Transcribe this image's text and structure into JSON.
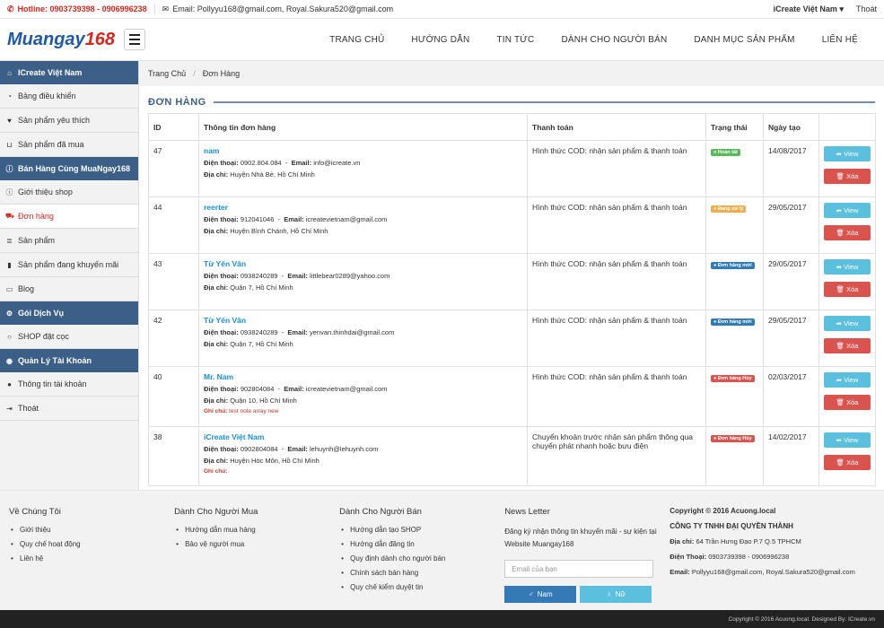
{
  "topbar": {
    "hotline": "Hotline: 0903739398 - 0906996238",
    "email": "Email: Pollyyu168@gmail.com, Royal.Sakura520@gmail.com",
    "user": "iCreate Việt Nam",
    "logout": "Thoát"
  },
  "logo": {
    "part1": "Muangay",
    "part2": "168"
  },
  "nav": [
    "TRANG CHỦ",
    "HƯỚNG DẪN",
    "TIN TỨC",
    "DÀNH CHO NGƯỜI BÁN",
    "DANH MỤC SẢN PHẨM",
    "LIÊN HỆ"
  ],
  "sidebar": {
    "h1": "ICreate Việt Nam",
    "g1": [
      "Bảng điều khiển",
      "Sản phẩm yêu thích",
      "Sản phẩm đã mua"
    ],
    "h2": "Bán Hàng Cùng MuaNgay168",
    "g2": [
      "Giới thiệu shop",
      "Đơn hàng",
      "Sản phẩm",
      "Sản phẩm đang khuyến mãi",
      "Blog"
    ],
    "h3": "Gói Dịch Vụ",
    "g3": [
      "SHOP đặt cọc"
    ],
    "h4": "Quản Lý Tài Khoản",
    "g4": [
      "Thông tin tài khoản",
      "Thoát"
    ]
  },
  "breadcrumb": {
    "home": "Trang Chủ",
    "current": "Đơn Hàng"
  },
  "page_title": "ĐƠN HÀNG",
  "table": {
    "headers": [
      "ID",
      "Thông tin đơn hàng",
      "Thanh toán",
      "Trạng thái",
      "Ngày tạo",
      ""
    ],
    "phone_label": "Điện thoại:",
    "email_label": "Email:",
    "addr_label": "Địa chỉ:",
    "note_label": "Ghi chú:",
    "view": "View",
    "delete": "Xóa",
    "rows": [
      {
        "id": "47",
        "name": "nam",
        "phone": "0902.804.084",
        "email": "info@icreate.vn",
        "addr": "Huyện Nhà Bè, Hồ Chí Minh",
        "note": "",
        "payment": "Hình thức COD: nhận sản phẩm & thanh toán",
        "status": "Hoàn tất",
        "status_color": "#5cb85c",
        "date": "14/08/2017"
      },
      {
        "id": "44",
        "name": "reerter",
        "phone": "912041046",
        "email": "icreatevietnam@gmail.com",
        "addr": "Huyện Bình Chánh, Hồ Chí Minh",
        "note": "",
        "payment": "Hình thức COD: nhận sản phẩm & thanh toán",
        "status": "Đang xử lý",
        "status_color": "#f0ad4e",
        "date": "29/05/2017"
      },
      {
        "id": "43",
        "name": "Từ Yến Vân",
        "phone": "0938240289",
        "email": "littlebear0289@yahoo.com",
        "addr": "Quận 7, Hồ Chí Minh",
        "note": "",
        "payment": "Hình thức COD: nhận sản phẩm & thanh toán",
        "status": "Đơn hàng mới",
        "status_color": "#337ab7",
        "date": "29/05/2017"
      },
      {
        "id": "42",
        "name": "Từ Yến Vân",
        "phone": "0938240289",
        "email": "yenvan.thinhdai@gmail.com",
        "addr": "Quận 7, Hồ Chí Minh",
        "note": "",
        "payment": "Hình thức COD: nhận sản phẩm & thanh toán",
        "status": "Đơn hàng mới",
        "status_color": "#337ab7",
        "date": "29/05/2017"
      },
      {
        "id": "40",
        "name": "Mr. Nam",
        "phone": "902804084",
        "email": "icreatevietnam@gmail.com",
        "addr": "Quận 10, Hồ Chí Minh",
        "note": "test note array new",
        "payment": "Hình thức COD: nhận sản phẩm & thanh toán",
        "status": "Đơn hàng Hủy",
        "status_color": "#d9534f",
        "date": "02/03/2017"
      },
      {
        "id": "38",
        "name": "iCreate Việt Nam",
        "phone": "0902804084",
        "email": "lehuynh@lehuynh.com",
        "addr": "Huyện Hóc Môn, Hồ Chí Minh",
        "note": "",
        "show_note": true,
        "payment": "Chuyển khoản trước nhận sản phẩm thông qua chuyển phát nhanh hoặc bưu điện",
        "status": "Đơn hàng Hủy",
        "status_color": "#d9534f",
        "date": "14/02/2017"
      }
    ]
  },
  "footer": {
    "c1": {
      "title": "Về Chúng Tôi",
      "items": [
        "Giới thiệu",
        "Quy chế hoạt động",
        "Liên hệ"
      ]
    },
    "c2": {
      "title": "Dành Cho Người Mua",
      "items": [
        "Hướng dẫn mua hàng",
        "Bảo vệ người mua"
      ]
    },
    "c3": {
      "title": "Dành Cho Người Bán",
      "items": [
        "Hướng dẫn tạo SHOP",
        "Hướng dẫn đăng tin",
        "Quy định dành cho người bán",
        "Chính sách bán hàng",
        "Quy chế kiểm duyệt tin"
      ]
    },
    "news": {
      "title": "News Letter",
      "text": "Đăng ký nhận thông tin khuyến mãi - sự kiện tại Website Muangay168",
      "placeholder": "Email của bạn",
      "male": "Nam",
      "female": "Nữ"
    },
    "copy": {
      "line1": "Copyright © 2016 Acuong.local",
      "company": "CÔNG TY TNHH ĐẠI QUYỀN THÀNH",
      "addr_label": "Địa chỉ:",
      "addr": "64 Trần Hưng Đạo P.7 Q.5 TPHCM",
      "phone_label": "Điện Thoại:",
      "phone": "0903739398 - 0906996238",
      "email_label": "Email:",
      "email": "Pollyyu168@gmail.com, Royal.Sakura520@gmail.com"
    }
  },
  "bottom": "Copyright © 2016 Acuong.local. Designed By: ICreate.vn"
}
